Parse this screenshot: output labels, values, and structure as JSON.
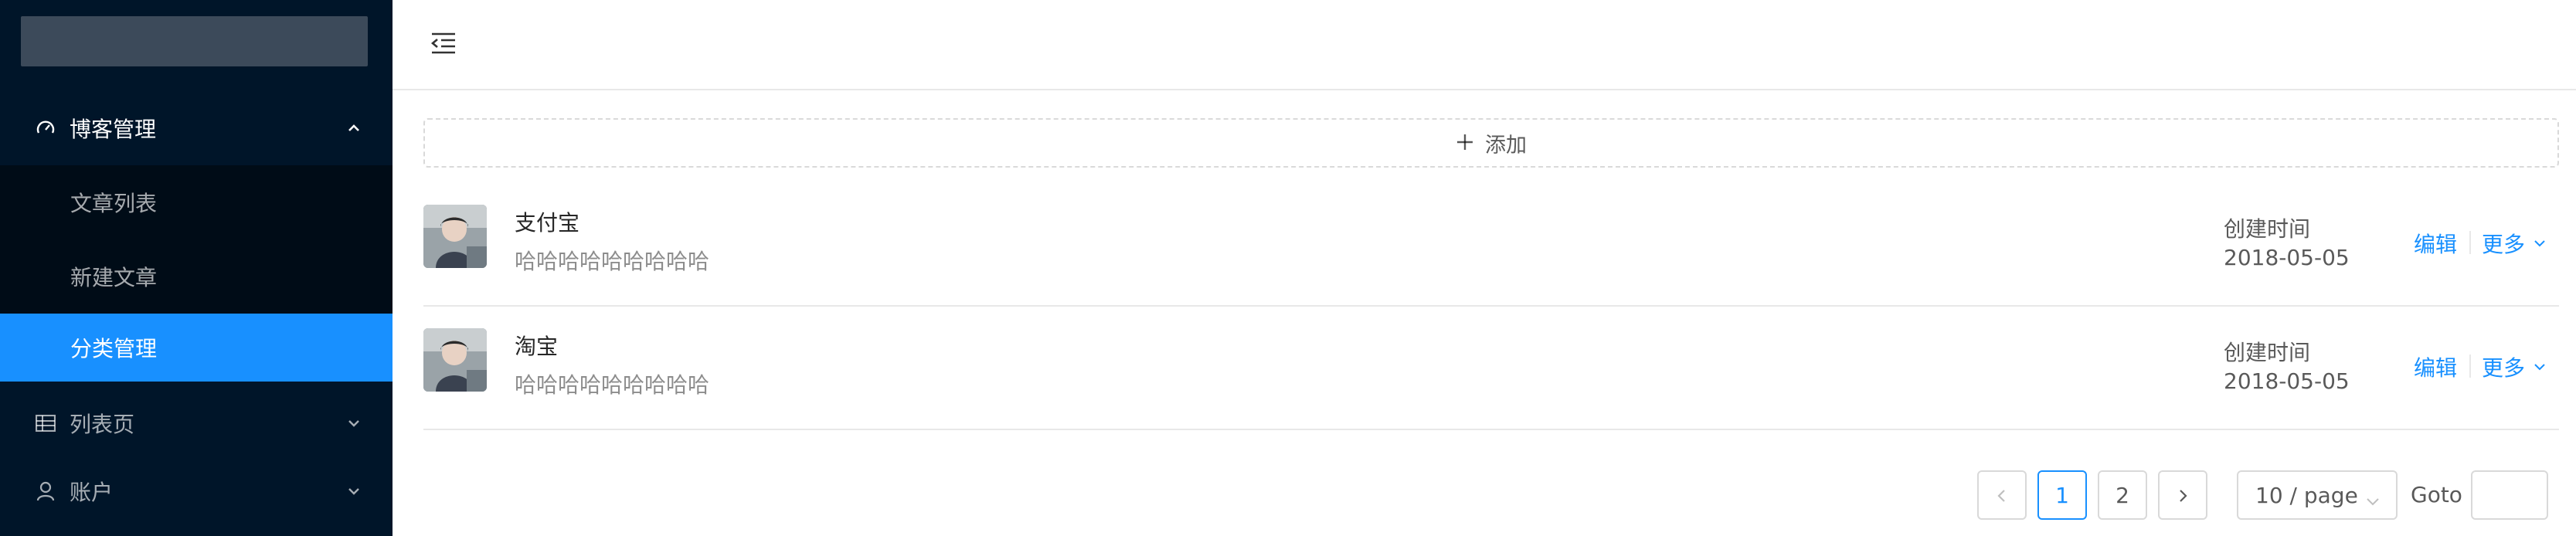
{
  "sidebar": {
    "menus": [
      {
        "label": "博客管理",
        "icon": "dashboard-icon",
        "open": true,
        "children": [
          {
            "label": "文章列表"
          },
          {
            "label": "新建文章"
          },
          {
            "label": "分类管理",
            "selected": true
          }
        ]
      },
      {
        "label": "列表页",
        "icon": "table-icon",
        "open": false
      },
      {
        "label": "账户",
        "icon": "user-icon",
        "open": false
      }
    ]
  },
  "header": {
    "trigger_icon": "menu-fold-icon"
  },
  "content": {
    "add_button_label": "添加",
    "items": [
      {
        "title": "支付宝",
        "description": "哈哈哈哈哈哈哈哈哈",
        "meta_label": "创建时间",
        "meta_value": "2018-05-05",
        "edit_label": "编辑",
        "more_label": "更多"
      },
      {
        "title": "淘宝",
        "description": "哈哈哈哈哈哈哈哈哈",
        "meta_label": "创建时间",
        "meta_value": "2018-05-05",
        "edit_label": "编辑",
        "more_label": "更多"
      }
    ]
  },
  "pagination": {
    "pages": [
      "1",
      "2"
    ],
    "current": "1",
    "page_size_label": "10 / page",
    "goto_label": "Goto",
    "goto_value": ""
  },
  "colors": {
    "sidebar_bg": "#001529",
    "submenu_bg": "#000c17",
    "primary": "#1890ff"
  }
}
